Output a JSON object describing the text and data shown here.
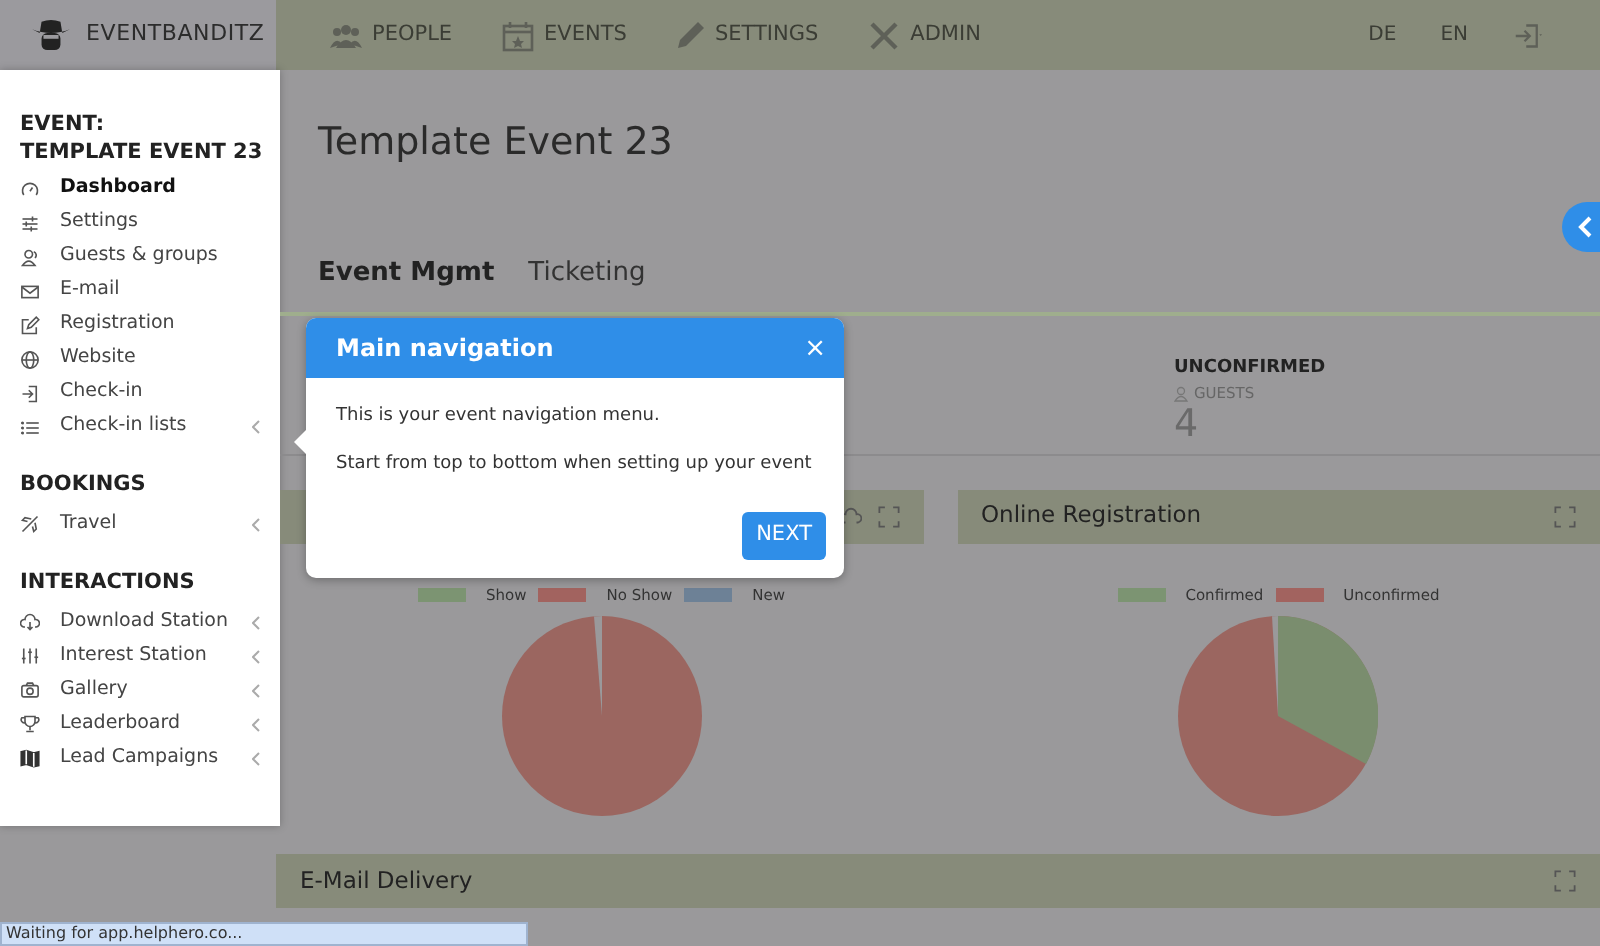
{
  "brand": {
    "name": "EVENTBANDITZ"
  },
  "top_nav": [
    {
      "label": "PEOPLE"
    },
    {
      "label": "EVENTS"
    },
    {
      "label": "SETTINGS"
    },
    {
      "label": "ADMIN"
    }
  ],
  "languages": [
    {
      "label": "DE"
    },
    {
      "label": "EN"
    }
  ],
  "sidebar": {
    "title_lines": [
      "EVENT:",
      "TEMPLATE EVENT 23"
    ],
    "sections": [
      {
        "items": [
          {
            "label": "Dashboard",
            "selected": true,
            "expandable": false
          },
          {
            "label": "Settings",
            "selected": false,
            "expandable": false
          },
          {
            "label": "Guests & groups",
            "selected": false,
            "expandable": false
          },
          {
            "label": "E-mail",
            "selected": false,
            "expandable": false
          },
          {
            "label": "Registration",
            "selected": false,
            "expandable": false
          },
          {
            "label": "Website",
            "selected": false,
            "expandable": false
          },
          {
            "label": "Check-in",
            "selected": false,
            "expandable": false
          },
          {
            "label": "Check-in lists",
            "selected": false,
            "expandable": true
          }
        ]
      },
      {
        "heading": "BOOKINGS",
        "items": [
          {
            "label": "Travel",
            "selected": false,
            "expandable": true
          }
        ]
      },
      {
        "heading": "INTERACTIONS",
        "items": [
          {
            "label": "Download Station",
            "selected": false,
            "expandable": true
          },
          {
            "label": "Interest Station",
            "selected": false,
            "expandable": true
          },
          {
            "label": "Gallery",
            "selected": false,
            "expandable": true
          },
          {
            "label": "Leaderboard",
            "selected": false,
            "expandable": true
          },
          {
            "label": "Lead Campaigns",
            "selected": false,
            "expandable": true
          }
        ]
      }
    ]
  },
  "page": {
    "title": "Template Event 23",
    "tabs": [
      {
        "label": "Event Mgmt",
        "selected": true
      },
      {
        "label": "Ticketing",
        "selected": false
      }
    ]
  },
  "stat": {
    "label": "UNCONFIRMED",
    "unit": "GUESTS",
    "value": "4"
  },
  "panels": [
    {
      "legend": [
        {
          "label": "Show",
          "color": "#7c9472"
        },
        {
          "label": "No Show",
          "color": "#a2635f"
        },
        {
          "label": "New",
          "color": "#6d8196"
        }
      ]
    },
    {
      "title": "Online Registration",
      "legend": [
        {
          "label": "Confirmed",
          "color": "#7c9472"
        },
        {
          "label": "Unconfirmed",
          "color": "#a2635f"
        }
      ]
    }
  ],
  "bottom_panel": {
    "title": "E-Mail Delivery"
  },
  "popover": {
    "title": "Main navigation",
    "close": "×",
    "lines": [
      "This is your event navigation menu.",
      "Start from top to bottom when setting up your event"
    ],
    "button": "NEXT"
  },
  "status_bar": "Waiting for app.helphero.co..."
}
